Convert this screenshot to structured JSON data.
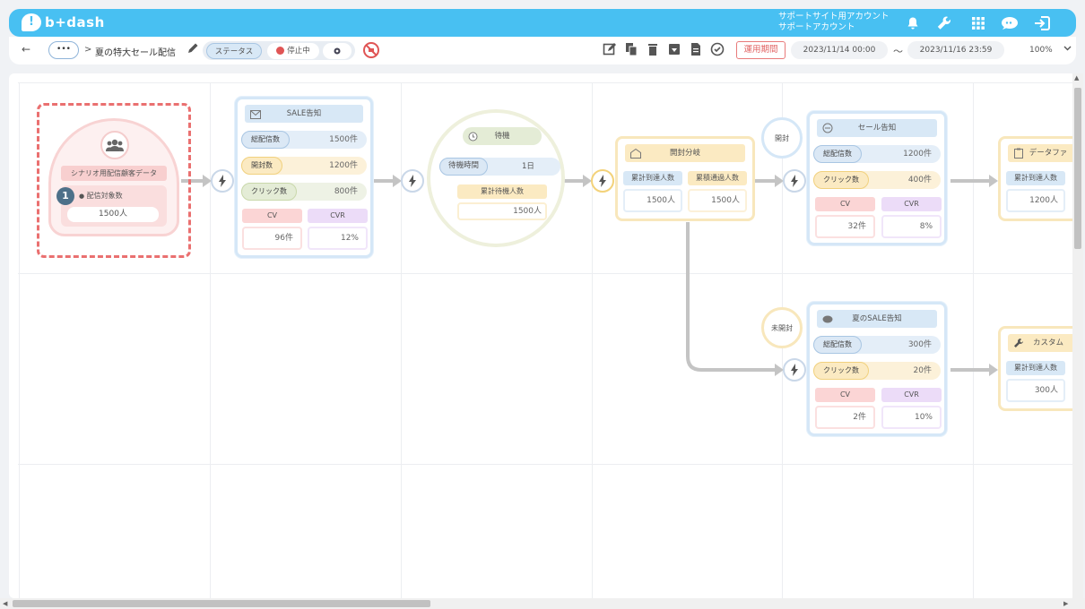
{
  "header": {
    "logo_mark": "!",
    "logo_text": "b+dash",
    "account_line1": "サポートサイト用アカウント",
    "account_line2": "サポートアカウント",
    "icons": [
      "bell-icon",
      "wrench-icon",
      "grid-icon",
      "chat-icon",
      "logout-icon"
    ]
  },
  "toolbar": {
    "back_label": "←",
    "more_label": "•••",
    "breadcrumb_sep": ">",
    "scenario_name": "夏の特大セール配信",
    "status_label": "ステータス",
    "status_value": "停止中",
    "period_button": "運用期間",
    "start_date": "2023/11/14 00:00",
    "tilde": "〜",
    "end_date": "2023/11/16 23:59",
    "zoom": "100%",
    "status_color": "#e05555",
    "accent_color": "#48c0f2"
  },
  "flow": {
    "start": {
      "title": "シナリオ用配信顧客データ",
      "badge": "1",
      "count_label": "配信対象数",
      "count_value": "1500人"
    },
    "sale_notice": {
      "title": "SALE告知",
      "rows": [
        {
          "label": "総配信数",
          "value": "1500件"
        },
        {
          "label": "開封数",
          "value": "1200件"
        },
        {
          "label": "クリック数",
          "value": "800件"
        }
      ],
      "cv_label": "CV",
      "cv_value": "96件",
      "cvr_label": "CVR",
      "cvr_value": "12%"
    },
    "wait": {
      "title": "待機",
      "time_label": "待機時間",
      "time_value": "1日",
      "total_label": "累計待機人数",
      "total_value": "1500人"
    },
    "open_branch": {
      "title": "開封分岐",
      "col1_label": "累計到達人数",
      "col1_value": "1500人",
      "col2_label": "累積通過人数",
      "col2_value": "1500人"
    },
    "pin_opened": "開封",
    "pin_unopened": "未開封",
    "sale_mail": {
      "title": "セール告知",
      "rows": [
        {
          "label": "総配信数",
          "value": "1200件"
        },
        {
          "label": "クリック数",
          "value": "400件"
        }
      ],
      "cv_label": "CV",
      "cv_value": "32件",
      "cvr_label": "CVR",
      "cvr_value": "8%"
    },
    "summer_sale": {
      "title": "夏のSALE告知",
      "rows": [
        {
          "label": "総配信数",
          "value": "300件"
        },
        {
          "label": "クリック数",
          "value": "20件"
        }
      ],
      "cv_label": "CV",
      "cv_value": "2件",
      "cvr_label": "CVR",
      "cvr_value": "10%"
    },
    "data_file": {
      "title": "データファ",
      "col1_label": "累計到達人数",
      "col1_value": "1200人"
    },
    "custom": {
      "title": "カスタム",
      "col1_label": "累計到達人数",
      "col1_value": "300人"
    }
  }
}
